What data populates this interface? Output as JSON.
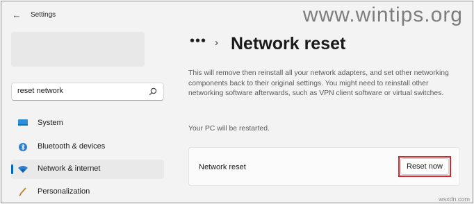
{
  "window": {
    "title": "Settings",
    "watermark": "www.wintips.org"
  },
  "search": {
    "value": "reset network"
  },
  "sidebar": {
    "items": [
      {
        "label": "System",
        "icon": "system-icon"
      },
      {
        "label": "Bluetooth & devices",
        "icon": "bluetooth-icon"
      },
      {
        "label": "Network & internet",
        "icon": "wifi-icon",
        "selected": true
      },
      {
        "label": "Personalization",
        "icon": "brush-icon"
      }
    ]
  },
  "main": {
    "breadcrumb_more": "•••",
    "title": "Network reset",
    "description": "This will remove then reinstall all your network adapters, and set other networking components back to their original settings. You might need to reinstall other networking software afterwards, such as VPN client software or virtual switches.",
    "restart_note": "Your PC will be restarted.",
    "card": {
      "label": "Network reset",
      "button_label": "Reset now"
    }
  },
  "footer_mark": "wsxdn.com",
  "colors": {
    "accent": "#0067c0",
    "highlight": "#d9262b",
    "background": "#f3f3f3"
  }
}
